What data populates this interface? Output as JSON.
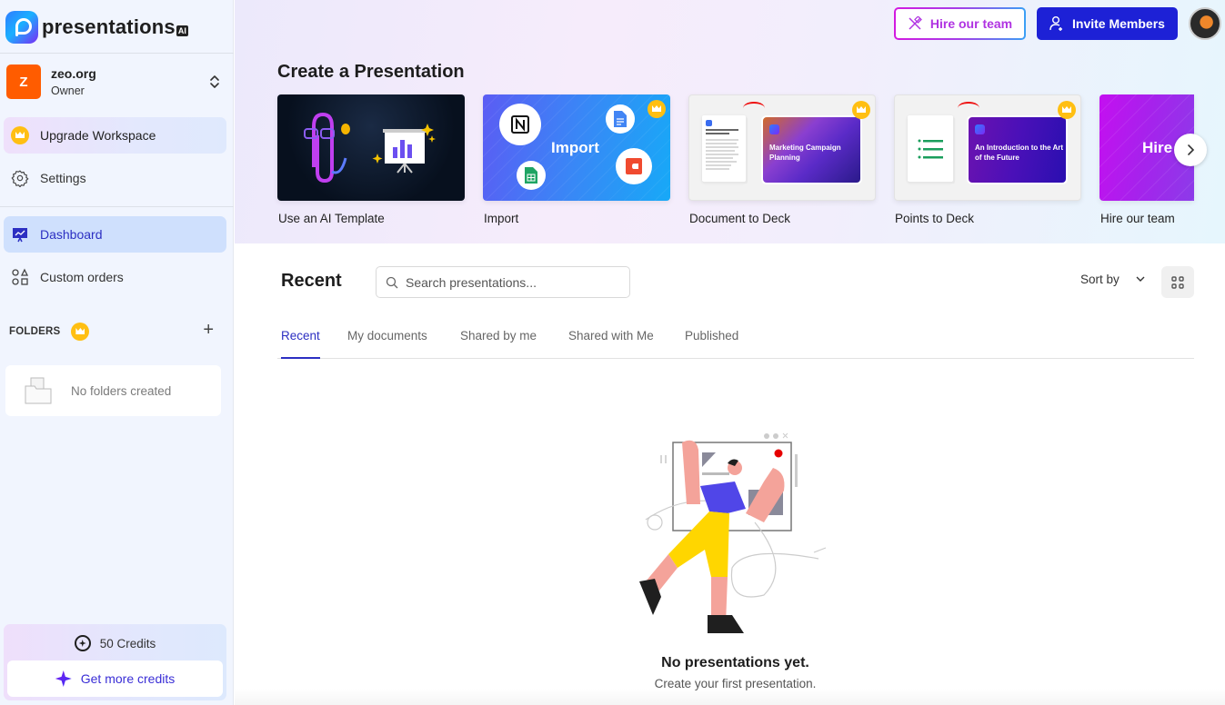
{
  "app": {
    "logo_text": "presentations",
    "logo_suffix": "AI"
  },
  "workspace": {
    "initial": "Z",
    "name": "zeo.org",
    "role": "Owner"
  },
  "sidebar": {
    "items": [
      {
        "label": "Upgrade Workspace",
        "icon": "crown-icon"
      },
      {
        "label": "Settings",
        "icon": "gear-icon"
      },
      {
        "label": "Dashboard",
        "icon": "presentation-board-icon",
        "active": true
      },
      {
        "label": "Custom orders",
        "icon": "shapes-icon"
      }
    ],
    "folders_label": "FOLDERS",
    "folders_add": "+",
    "folders_empty": "No folders created",
    "credits": "50 Credits",
    "get_credits": "Get more credits"
  },
  "topbar": {
    "hire_label": "Hire our team",
    "invite_label": "Invite Members"
  },
  "create": {
    "title": "Create a Presentation",
    "templates": [
      {
        "label": "Use an AI Template",
        "premium": false
      },
      {
        "label": "Import",
        "card_text": "Import",
        "premium": true
      },
      {
        "label": "Document to Deck",
        "slide_title": "Marketing Campaign Planning",
        "premium": true
      },
      {
        "label": "Points to Deck",
        "slide_title": "An Introduction to the Art of the Future",
        "premium": true
      },
      {
        "label": "Hire our team",
        "card_text": "Hire",
        "premium": false
      }
    ],
    "next_symbol": "›"
  },
  "recent": {
    "title": "Recent",
    "search_placeholder": "Search presentations...",
    "sort_label": "Sort by",
    "tabs": [
      {
        "label": "Recent",
        "active": true
      },
      {
        "label": "My documents"
      },
      {
        "label": "Shared by me"
      },
      {
        "label": "Shared with Me"
      },
      {
        "label": "Published"
      }
    ],
    "empty_title": "No presentations yet.",
    "empty_subtitle": "Create your first presentation."
  },
  "colors": {
    "accent": "#2c2fc2",
    "invite_bg": "#1d21d6",
    "workspace_avatar": "#ff5c00",
    "premium": "#ffbf12"
  }
}
